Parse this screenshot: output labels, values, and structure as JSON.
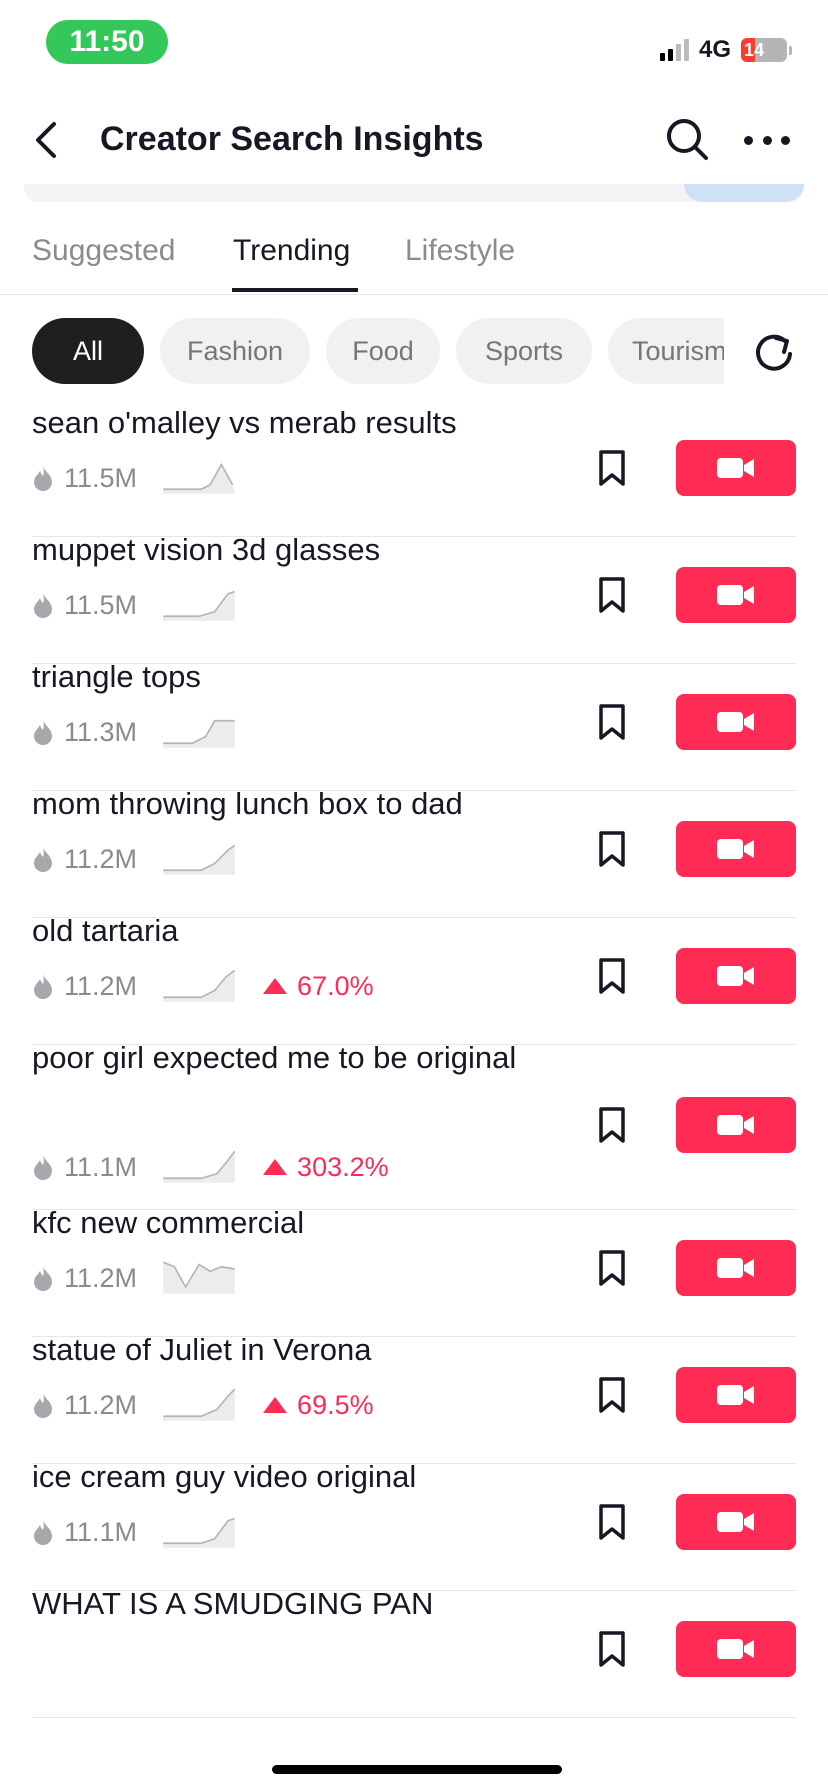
{
  "status_bar": {
    "time": "11:50",
    "network": "4G",
    "battery": "14"
  },
  "nav": {
    "title": "Creator Search Insights",
    "back_icon": "chevron-left-icon",
    "search_icon": "search-icon",
    "more_icon": "more-icon"
  },
  "tabs": [
    {
      "label": "Suggested",
      "active": false
    },
    {
      "label": "Trending",
      "active": true
    },
    {
      "label": "Lifestyle",
      "active": false
    }
  ],
  "chips": [
    {
      "label": "All",
      "active": true
    },
    {
      "label": "Fashion",
      "active": false
    },
    {
      "label": "Food",
      "active": false
    },
    {
      "label": "Sports",
      "active": false
    },
    {
      "label": "Tourism",
      "active": false
    }
  ],
  "colors": {
    "accent": "#fe2c55",
    "text": "#161823",
    "muted": "#8a8b91",
    "chip_bg": "#f1f1f2"
  },
  "rows": [
    {
      "title": "sean o'malley vs merab results",
      "count": "11.5M",
      "trend": ""
    },
    {
      "title": "muppet vision 3d glasses",
      "count": "11.5M",
      "trend": ""
    },
    {
      "title": "triangle tops",
      "count": "11.3M",
      "trend": ""
    },
    {
      "title": "mom throwing lunch box to dad",
      "count": "11.2M",
      "trend": ""
    },
    {
      "title": "old tartaria",
      "count": "11.2M",
      "trend": "67.0%"
    },
    {
      "title": "poor girl expected me to be original",
      "count": "11.1M",
      "trend": "303.2%"
    },
    {
      "title": "kfc new commercial",
      "count": "11.2M",
      "trend": ""
    },
    {
      "title": "statue of Juliet in Verona",
      "count": "11.2M",
      "trend": "69.5%"
    },
    {
      "title": "ice cream guy video original",
      "count": "11.1M",
      "trend": ""
    },
    {
      "title": "WHAT IS A SMUDGING PAN",
      "count": "",
      "trend": ""
    }
  ]
}
